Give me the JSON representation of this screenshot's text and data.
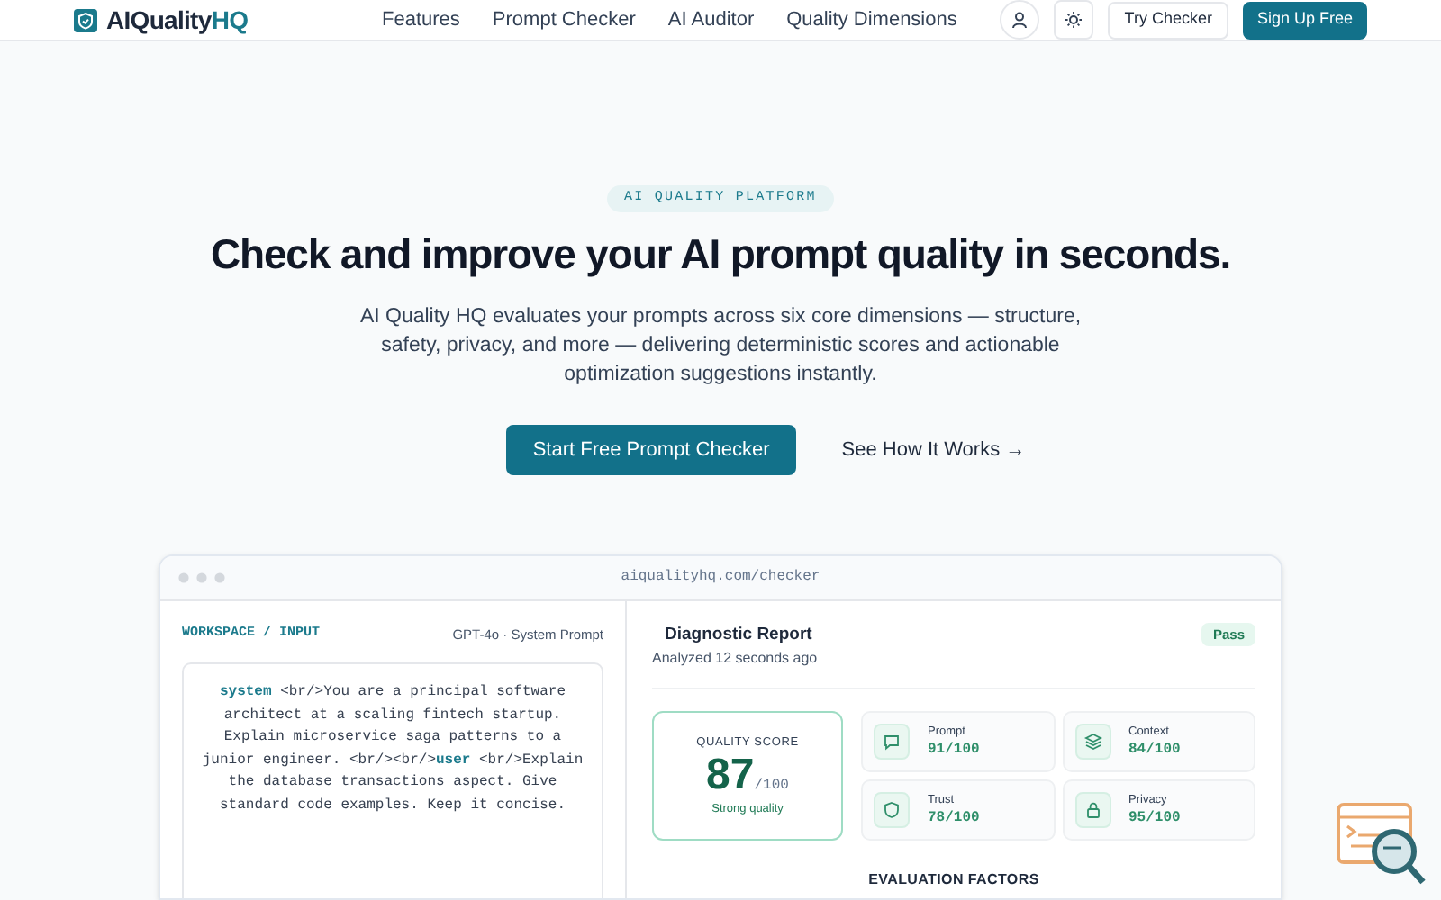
{
  "header": {
    "logo": {
      "name": "AIQuality",
      "accent": "HQ"
    },
    "nav": [
      "Features",
      "Prompt Checker",
      "AI Auditor",
      "Quality Dimensions"
    ],
    "try_button": "Try Checker",
    "signup_button": "Sign Up Free"
  },
  "hero": {
    "badge": "AI QUALITY PLATFORM",
    "title": "Check and improve your AI prompt quality in seconds.",
    "description": "AI Quality HQ evaluates your prompts across six core dimensions — structure, safety, privacy, and more — delivering deterministic scores and actionable optimization suggestions instantly.",
    "primary_button": "Start Free Prompt Checker",
    "secondary_link": "See How It Works →"
  },
  "preview": {
    "url": "aiqualityhq.com/checker",
    "workspace": {
      "path": "WORKSPACE / INPUT",
      "model": "GPT-4o · System Prompt",
      "prompt": [
        {
          "kind": "role",
          "text": "system"
        },
        {
          "kind": "plain",
          "text": " <br/>You are a principal software architect at a scaling fintech startup. Explain microservice saga patterns to a junior engineer. <br/><br/>"
        },
        {
          "kind": "role",
          "text": "user"
        },
        {
          "kind": "plain",
          "text": " <br/>Explain the database transactions aspect. Give standard code examples. Keep it concise."
        }
      ]
    },
    "report": {
      "title": "Diagnostic Report",
      "subtitle": "Analyzed 12 seconds ago",
      "status": "Pass",
      "score": {
        "label": "QUALITY SCORE",
        "value": "87",
        "max": "/100",
        "verdict": "Strong quality"
      },
      "metrics": [
        {
          "kind": "chat",
          "label": "Prompt",
          "value": "91/100"
        },
        {
          "kind": "layers",
          "label": "Context",
          "value": "84/100"
        },
        {
          "kind": "shield",
          "label": "Trust",
          "value": "78/100"
        },
        {
          "kind": "lock",
          "label": "Privacy",
          "value": "95/100"
        }
      ],
      "section_title": "EVALUATION FACTORS"
    }
  }
}
